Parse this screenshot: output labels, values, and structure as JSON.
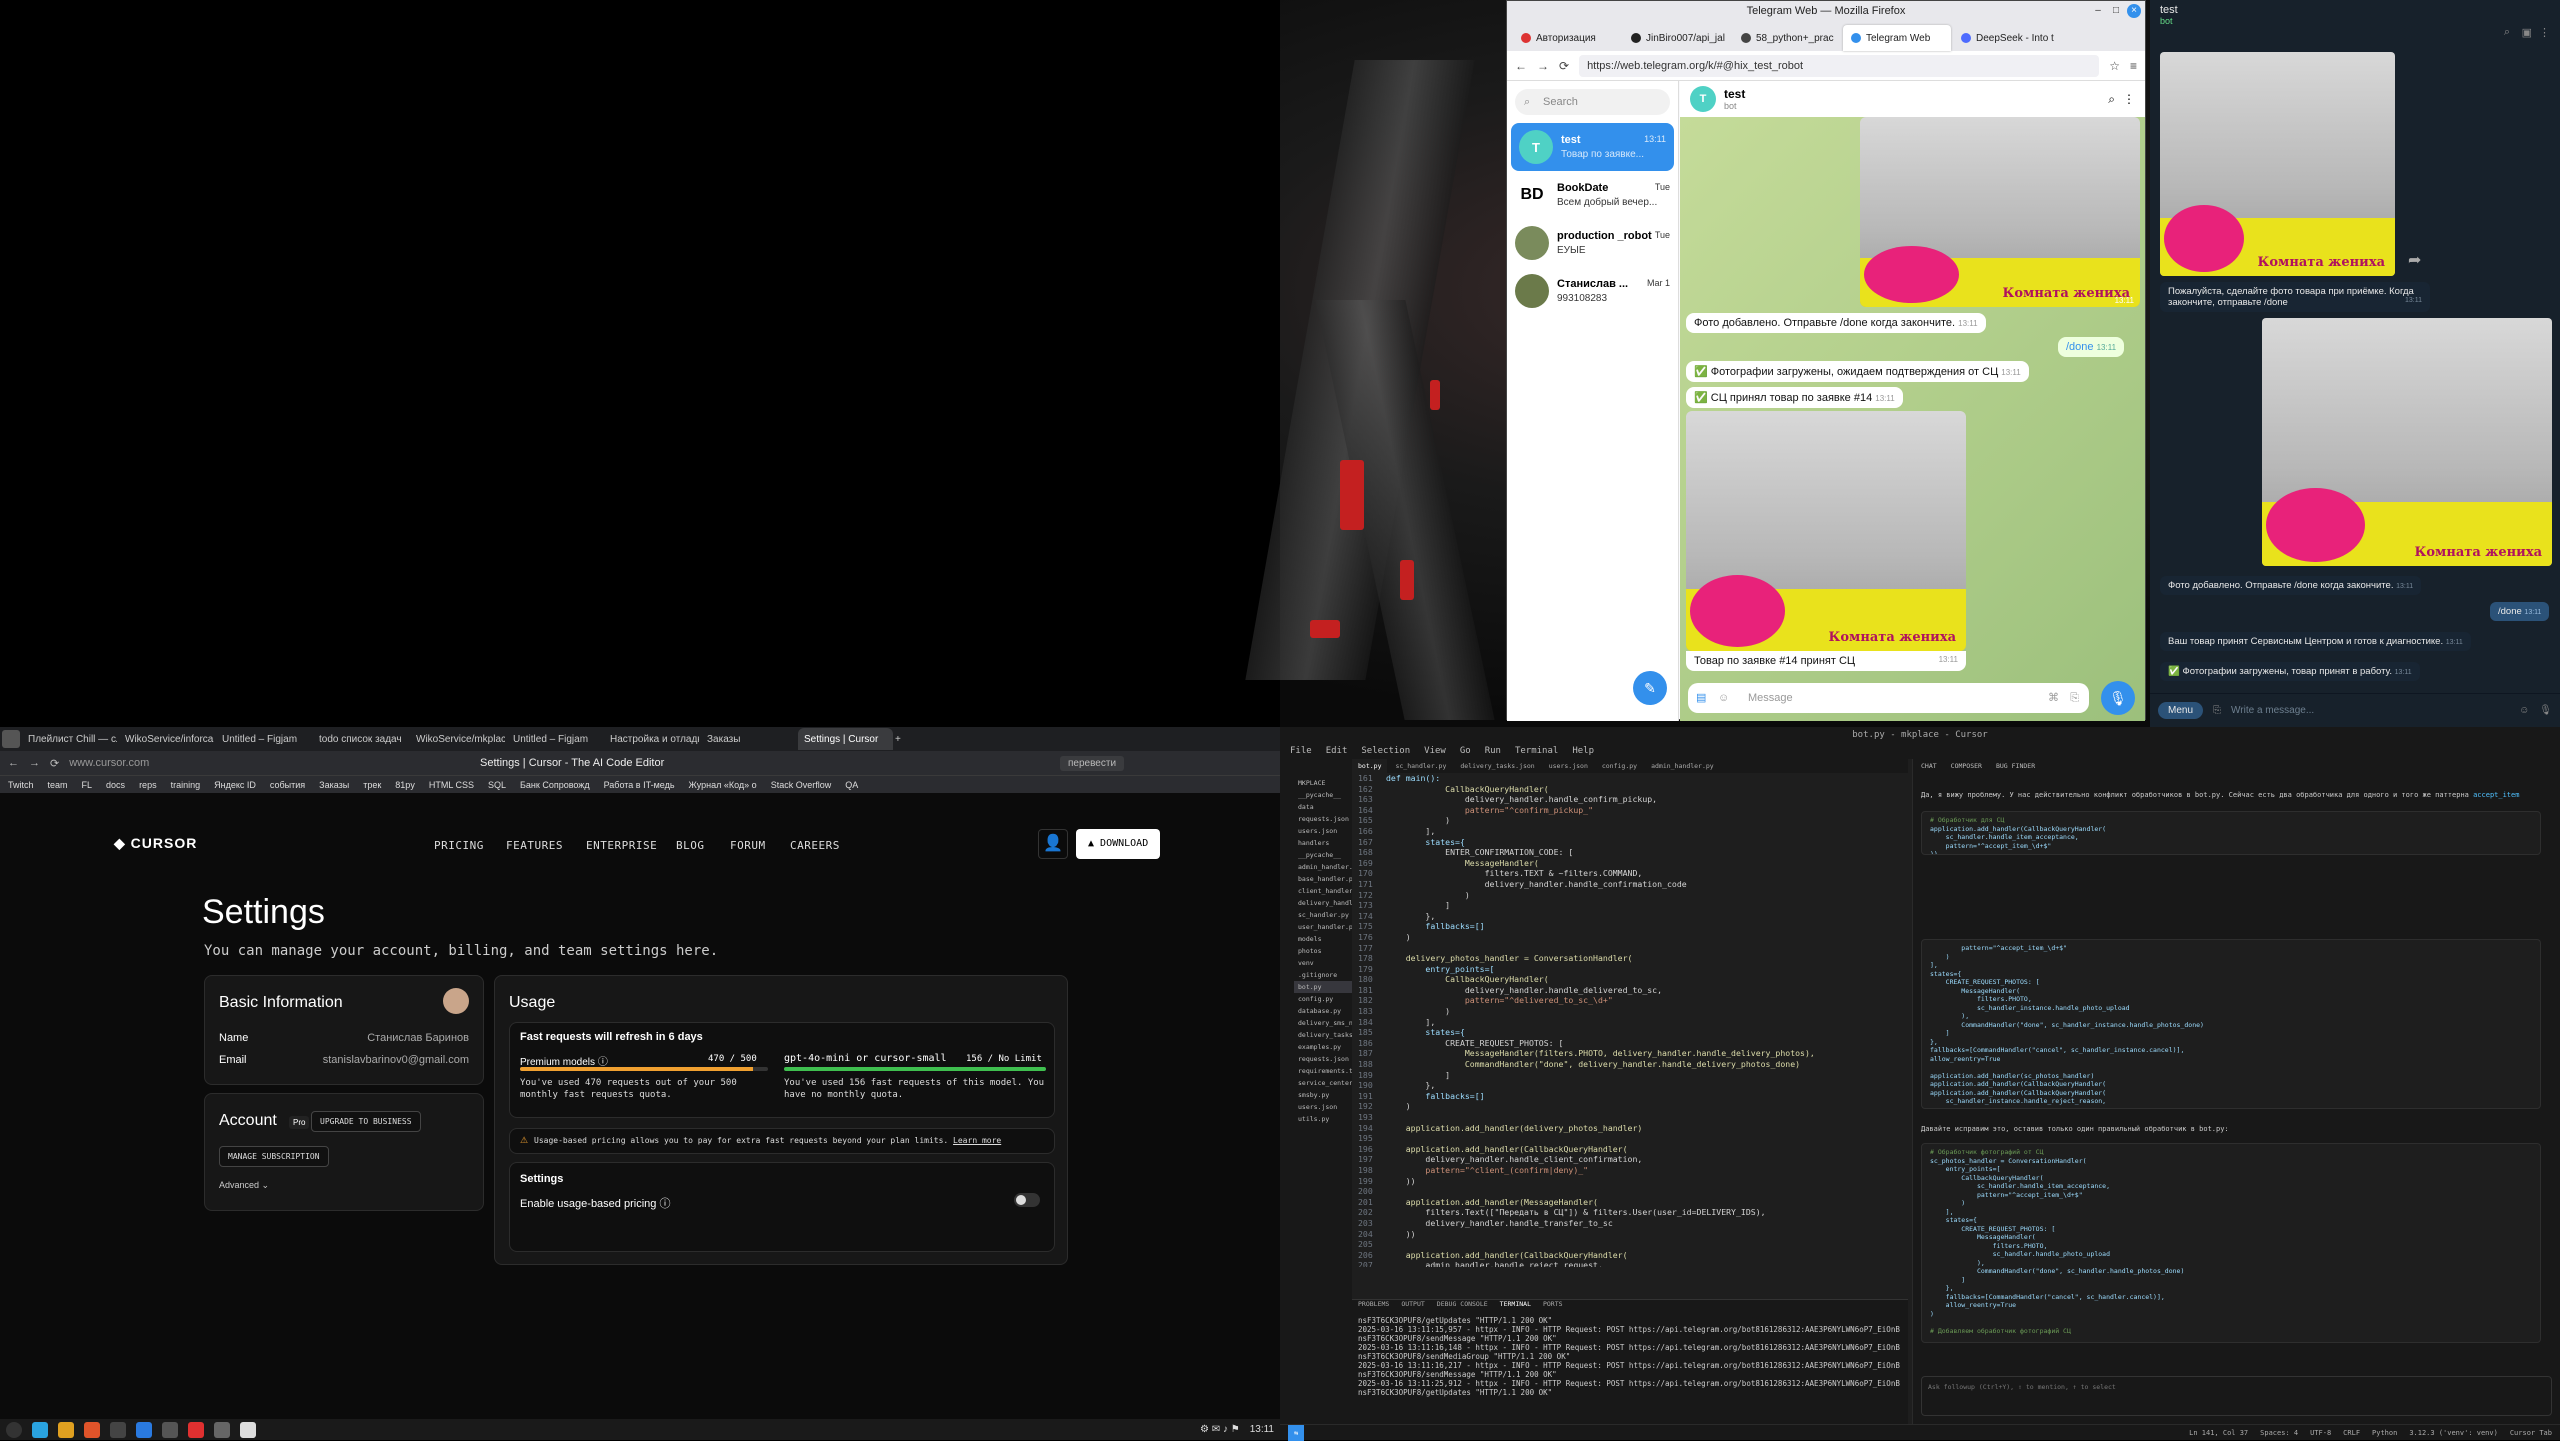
{
  "telegram_web": {
    "window_title": "Telegram Web — Mozilla Firefox",
    "tabs": [
      "Авторизация",
      "JinBiro007/api_jal",
      "58_python+_prac",
      "Telegram Web",
      "DeepSeek - Into t"
    ],
    "url": "https://web.telegram.org/k/#@hix_test_robot",
    "search_placeholder": "Search",
    "chats": [
      {
        "name": "test",
        "time": "13:11",
        "preview": "Товар по заявке...",
        "avatar": "T"
      },
      {
        "name": "BookDate",
        "time": "Tue",
        "preview": "Всем добрый вечер...",
        "avatar": "BD"
      },
      {
        "name": "production _robot",
        "time": "Tue",
        "preview": "ЕУЫЕ",
        "avatar": ""
      },
      {
        "name": "Станислав ...",
        "time": "Mar 1",
        "preview": "993108283",
        "avatar": ""
      }
    ],
    "header_name": "test",
    "header_status": "bot",
    "banner_text": "Комната жениха",
    "photo_time": "13:11",
    "msg_photo_added": "Фото добавлено. Отправьте /done когда закончите.",
    "msg_photo_added_time": "13:11",
    "msg_done": "/done",
    "msg_done_time": "13:11",
    "msg_uploaded": "✅ Фотографии загружены, ожидаем подтверждения от СЦ",
    "msg_uploaded_time": "13:11",
    "msg_accepted": "✅ СЦ принял товар по заявке #14",
    "msg_accepted_time": "13:11",
    "msg_caption": "Товар по заявке #14 принят СЦ",
    "msg_caption_time": "13:11",
    "input_placeholder": "Message"
  },
  "telegram_desktop": {
    "title": "test",
    "subtitle": "bot",
    "msg1": "Пожалуйста, сделайте фото товара при приёмке. Когда закончите, отправьте /done",
    "msg1_time": "13:11",
    "msg2": "Фото добавлено. Отправьте /done когда закончите.",
    "msg2_time": "13:11",
    "msg3": "/done",
    "msg3_time": "13:11",
    "msg4": "Ваш товар принят Сервисным Центром и готов к диагностике.",
    "msg4_time": "13:11",
    "msg5": "✅ Фотографии загружены, товар принят в работу.",
    "msg5_time": "13:11",
    "menu_label": "Menu",
    "input_placeholder": "Write a message..."
  },
  "browser": {
    "tabs": [
      "Плейлист Chill — слу",
      "WikoService/inforcar",
      "Untitled – Figjam",
      "todo список задач",
      "WikoService/mkplace",
      "Untitled – Figjam",
      "Настройка и отладка",
      "Заказы",
      "Settings | Cursor"
    ],
    "url": "www.cursor.com",
    "page_title": "Settings | Cursor - The AI Code Editor",
    "translate": "перевести",
    "bookmarks": [
      "Twitch",
      "team",
      "FL",
      "docs",
      "reps",
      "training",
      "Яндекс ID",
      "события",
      "Заказы",
      "трек",
      "81py",
      "HTML CSS",
      "SQL",
      "Банк Сопровожд",
      "Работа в IT-медь",
      "Журнал «Код» о",
      "Stack Overflow",
      "QA"
    ]
  },
  "cursor_site": {
    "logo": "CURSOR",
    "nav": [
      "PRICING",
      "FEATURES",
      "ENTERPRISE",
      "BLOG",
      "FORUM",
      "CAREERS"
    ],
    "download": "DOWNLOAD",
    "heading": "Settings",
    "subheading": "You can manage your account, billing, and team settings here.",
    "basic_info": {
      "title": "Basic Information",
      "name_label": "Name",
      "name_value": "Станислав Баринов",
      "email_label": "Email",
      "email_value": "stanislavbarinov0@gmail.com"
    },
    "account": {
      "title": "Account",
      "plan": "Pro",
      "upgrade": "UPGRADE TO BUSINESS",
      "manage": "MANAGE SUBSCRIPTION",
      "advanced": "Advanced"
    },
    "usage": {
      "title": "Usage",
      "refresh_note": "Fast requests will refresh in 6 days",
      "premium_label": "Premium models",
      "premium_count": "470 / 500",
      "premium_fraction": 0.94,
      "premium_desc": "You've used 470 requests out of your 500 monthly fast requests quota.",
      "small_label": "gpt-4o-mini or cursor-small",
      "small_count": "156 / No Limit",
      "small_fraction": 1.0,
      "small_desc": "You've used 156 fast requests of this model. You have no monthly quota.",
      "notice": "Usage-based pricing allows you to pay for extra fast requests beyond your plan limits.",
      "learn_more": "Learn more",
      "settings_title": "Settings",
      "usage_pricing_label": "Enable usage-based pricing"
    },
    "accent_orange": "#f0a030",
    "accent_green": "#3fbf4f"
  },
  "taskbar": {
    "clock": "13:11"
  },
  "editor": {
    "title": "bot.py - mkplace - Cursor",
    "menu": [
      "File",
      "Edit",
      "Selection",
      "View",
      "Go",
      "Run",
      "Terminal",
      "Help"
    ],
    "explorer_items": [
      "MKPLACE",
      "__pycache__",
      "data",
      "requests.json",
      "users.json",
      "handlers",
      "__pycache__",
      "admin_handler.py",
      "base_handler.py",
      "client_handler.py",
      "delivery_handler.py",
      "sc_handler.py",
      "user_handler.py",
      "models",
      "photos",
      "venv",
      ".gitignore",
      "bot.py",
      "config.py",
      "database.py",
      "delivery_sms_notific...",
      "delivery_tasks.json",
      "examples.py",
      "requests.json",
      "requirements.txt",
      "service_centers.json",
      "smsby.py",
      "users.json",
      "utils.py"
    ],
    "editor_tabs": [
      "bot.py",
      "sc_handler.py",
      "delivery_tasks.json",
      "users.json",
      "config.py",
      "admin_handler.py"
    ],
    "code_lines": [
      {
        "n": "161",
        "t": "def main():"
      },
      {
        "n": "162",
        "t": "            CallbackQueryHandler("
      },
      {
        "n": "163",
        "t": "                delivery_handler.handle_confirm_pickup,"
      },
      {
        "n": "164",
        "t": "                pattern=\"^confirm_pickup_\""
      },
      {
        "n": "165",
        "t": "            )"
      },
      {
        "n": "166",
        "t": "        ],"
      },
      {
        "n": "167",
        "t": "        states={"
      },
      {
        "n": "168",
        "t": "            ENTER_CONFIRMATION_CODE: ["
      },
      {
        "n": "169",
        "t": "                MessageHandler("
      },
      {
        "n": "170",
        "t": "                    filters.TEXT & ~filters.COMMAND,"
      },
      {
        "n": "171",
        "t": "                    delivery_handler.handle_confirmation_code"
      },
      {
        "n": "172",
        "t": "                )"
      },
      {
        "n": "173",
        "t": "            ]"
      },
      {
        "n": "174",
        "t": "        },"
      },
      {
        "n": "175",
        "t": "        fallbacks=[]"
      },
      {
        "n": "176",
        "t": "    )"
      },
      {
        "n": "177",
        "t": ""
      },
      {
        "n": "178",
        "t": "    delivery_photos_handler = ConversationHandler("
      },
      {
        "n": "179",
        "t": "        entry_points=["
      },
      {
        "n": "180",
        "t": "            CallbackQueryHandler("
      },
      {
        "n": "181",
        "t": "                delivery_handler.handle_delivered_to_sc,"
      },
      {
        "n": "182",
        "t": "                pattern=\"^delivered_to_sc_\\d+\""
      },
      {
        "n": "183",
        "t": "            )"
      },
      {
        "n": "184",
        "t": "        ],"
      },
      {
        "n": "185",
        "t": "        states={"
      },
      {
        "n": "186",
        "t": "            CREATE_REQUEST_PHOTOS: ["
      },
      {
        "n": "187",
        "t": "                MessageHandler(filters.PHOTO, delivery_handler.handle_delivery_photos),"
      },
      {
        "n": "188",
        "t": "                CommandHandler(\"done\", delivery_handler.handle_delivery_photos_done)"
      },
      {
        "n": "189",
        "t": "            ]"
      },
      {
        "n": "190",
        "t": "        },"
      },
      {
        "n": "191",
        "t": "        fallbacks=[]"
      },
      {
        "n": "192",
        "t": "    )"
      },
      {
        "n": "193",
        "t": ""
      },
      {
        "n": "194",
        "t": "    application.add_handler(delivery_photos_handler)"
      },
      {
        "n": "195",
        "t": ""
      },
      {
        "n": "196",
        "t": "    application.add_handler(CallbackQueryHandler("
      },
      {
        "n": "197",
        "t": "        delivery_handler.handle_client_confirmation,"
      },
      {
        "n": "198",
        "t": "        pattern=\"^client_(confirm|deny)_\""
      },
      {
        "n": "199",
        "t": "    ))"
      },
      {
        "n": "200",
        "t": ""
      },
      {
        "n": "201",
        "t": "    application.add_handler(MessageHandler("
      },
      {
        "n": "202",
        "t": "        filters.Text([\"Передать в СЦ\"]) & filters.User(user_id=DELIVERY_IDS),"
      },
      {
        "n": "203",
        "t": "        delivery_handler.handle_transfer_to_sc"
      },
      {
        "n": "204",
        "t": "    ))"
      },
      {
        "n": "205",
        "t": ""
      },
      {
        "n": "206",
        "t": "    application.add_handler(CallbackQueryHandler("
      },
      {
        "n": "207",
        "t": "        admin_handler.handle_reject_request,"
      }
    ],
    "panel_tabs": [
      "PROBLEMS",
      "OUTPUT",
      "DEBUG CONSOLE",
      "TERMINAL",
      "PORTS"
    ],
    "terminal_lines": [
      "nsF3T6CK3OPUF8/getUpdates \"HTTP/1.1 200 OK\"",
      "2025-03-16 13:11:15,957 - httpx - INFO - HTTP Request: POST https://api.telegram.org/bot8161286312:AAE3P6NYLWN6oP7_EiOnB",
      "nsF3T6CK3OPUF8/sendMessage \"HTTP/1.1 200 OK\"",
      "2025-03-16 13:11:16,148 - httpx - INFO - HTTP Request: POST https://api.telegram.org/bot8161286312:AAE3P6NYLWN6oP7_EiOnB",
      "nsF3T6CK3OPUF8/sendMediaGroup \"HTTP/1.1 200 OK\"",
      "2025-03-16 13:11:16,217 - httpx - INFO - HTTP Request: POST https://api.telegram.org/bot8161286312:AAE3P6NYLWN6oP7_EiOnB",
      "nsF3T6CK3OPUF8/sendMessage \"HTTP/1.1 200 OK\"",
      "2025-03-16 13:11:25,912 - httpx - INFO - HTTP Request: POST https://api.telegram.org/bot8161286312:AAE3P6NYLWN6oP7_EiOnB",
      "nsF3T6CK3OPUF8/getUpdates \"HTTP/1.1 200 OK\""
    ],
    "chat_tabs": [
      "CHAT",
      "COMPOSER",
      "BUG FINDER"
    ],
    "chat_intro": "Да, я вижу проблему. У нас действительно конфликт обработчиков в bot.py. Сейчас есть два обработчика для одного и того же паттерна",
    "chat_pattern": "accept_item",
    "chat_block1": [
      "# Обработчик для СЦ",
      "application.add_handler(CallbackQueryHandler(",
      "    sc_handler.handle_item_acceptance,",
      "    pattern=\"^accept_item_\\d+$\"",
      "))"
    ],
    "chat_block2": [
      "        pattern=\"^accept_item_\\d+$\"",
      "    )",
      "],",
      "states={",
      "    CREATE_REQUEST_PHOTOS: [",
      "        MessageHandler(",
      "            filters.PHOTO,",
      "            sc_handler_instance.handle_photo_upload",
      "        ),",
      "        CommandHandler(\"done\", sc_handler_instance.handle_photos_done)",
      "    ]",
      "},",
      "fallbacks=[CommandHandler(\"cancel\", sc_handler_instance.cancel)],",
      "allow_reentry=True",
      "",
      "application.add_handler(sc_photos_handler)",
      "application.add_handler(CallbackQueryHandler(",
      "application.add_handler(CallbackQueryHandler(",
      "    sc_handler_instance.handle_reject_reason,"
    ],
    "chat_fix_text": "Давайте исправим это, оставив только один правильный обработчик в bot.py:",
    "chat_block3": [
      "# Обработчик фотографий от СЦ",
      "sc_photos_handler = ConversationHandler(",
      "    entry_points=[",
      "        CallbackQueryHandler(",
      "            sc_handler.handle_item_acceptance,",
      "            pattern=\"^accept_item_\\d+$\"",
      "        )",
      "    ],",
      "    states={",
      "        CREATE_REQUEST_PHOTOS: [",
      "            MessageHandler(",
      "                filters.PHOTO,",
      "                sc_handler.handle_photo_upload",
      "            ),",
      "            CommandHandler(\"done\", sc_handler.handle_photos_done)",
      "        ]",
      "    },",
      "    fallbacks=[CommandHandler(\"cancel\", sc_handler.cancel)],",
      "    allow_reentry=True",
      ")",
      "",
      "# Добавляем обработчик фотографий СЦ"
    ],
    "chat_input_placeholder": "Ask followup (Ctrl+Y), ⇧ to mention, ↑ to select",
    "status_left": "Ln 141, Col 37",
    "status_items": [
      "Spaces: 4",
      "UTF-8",
      "CRLF",
      "Python",
      "3.12.3 ('venv': venv)",
      "Cursor Tab"
    ]
  }
}
